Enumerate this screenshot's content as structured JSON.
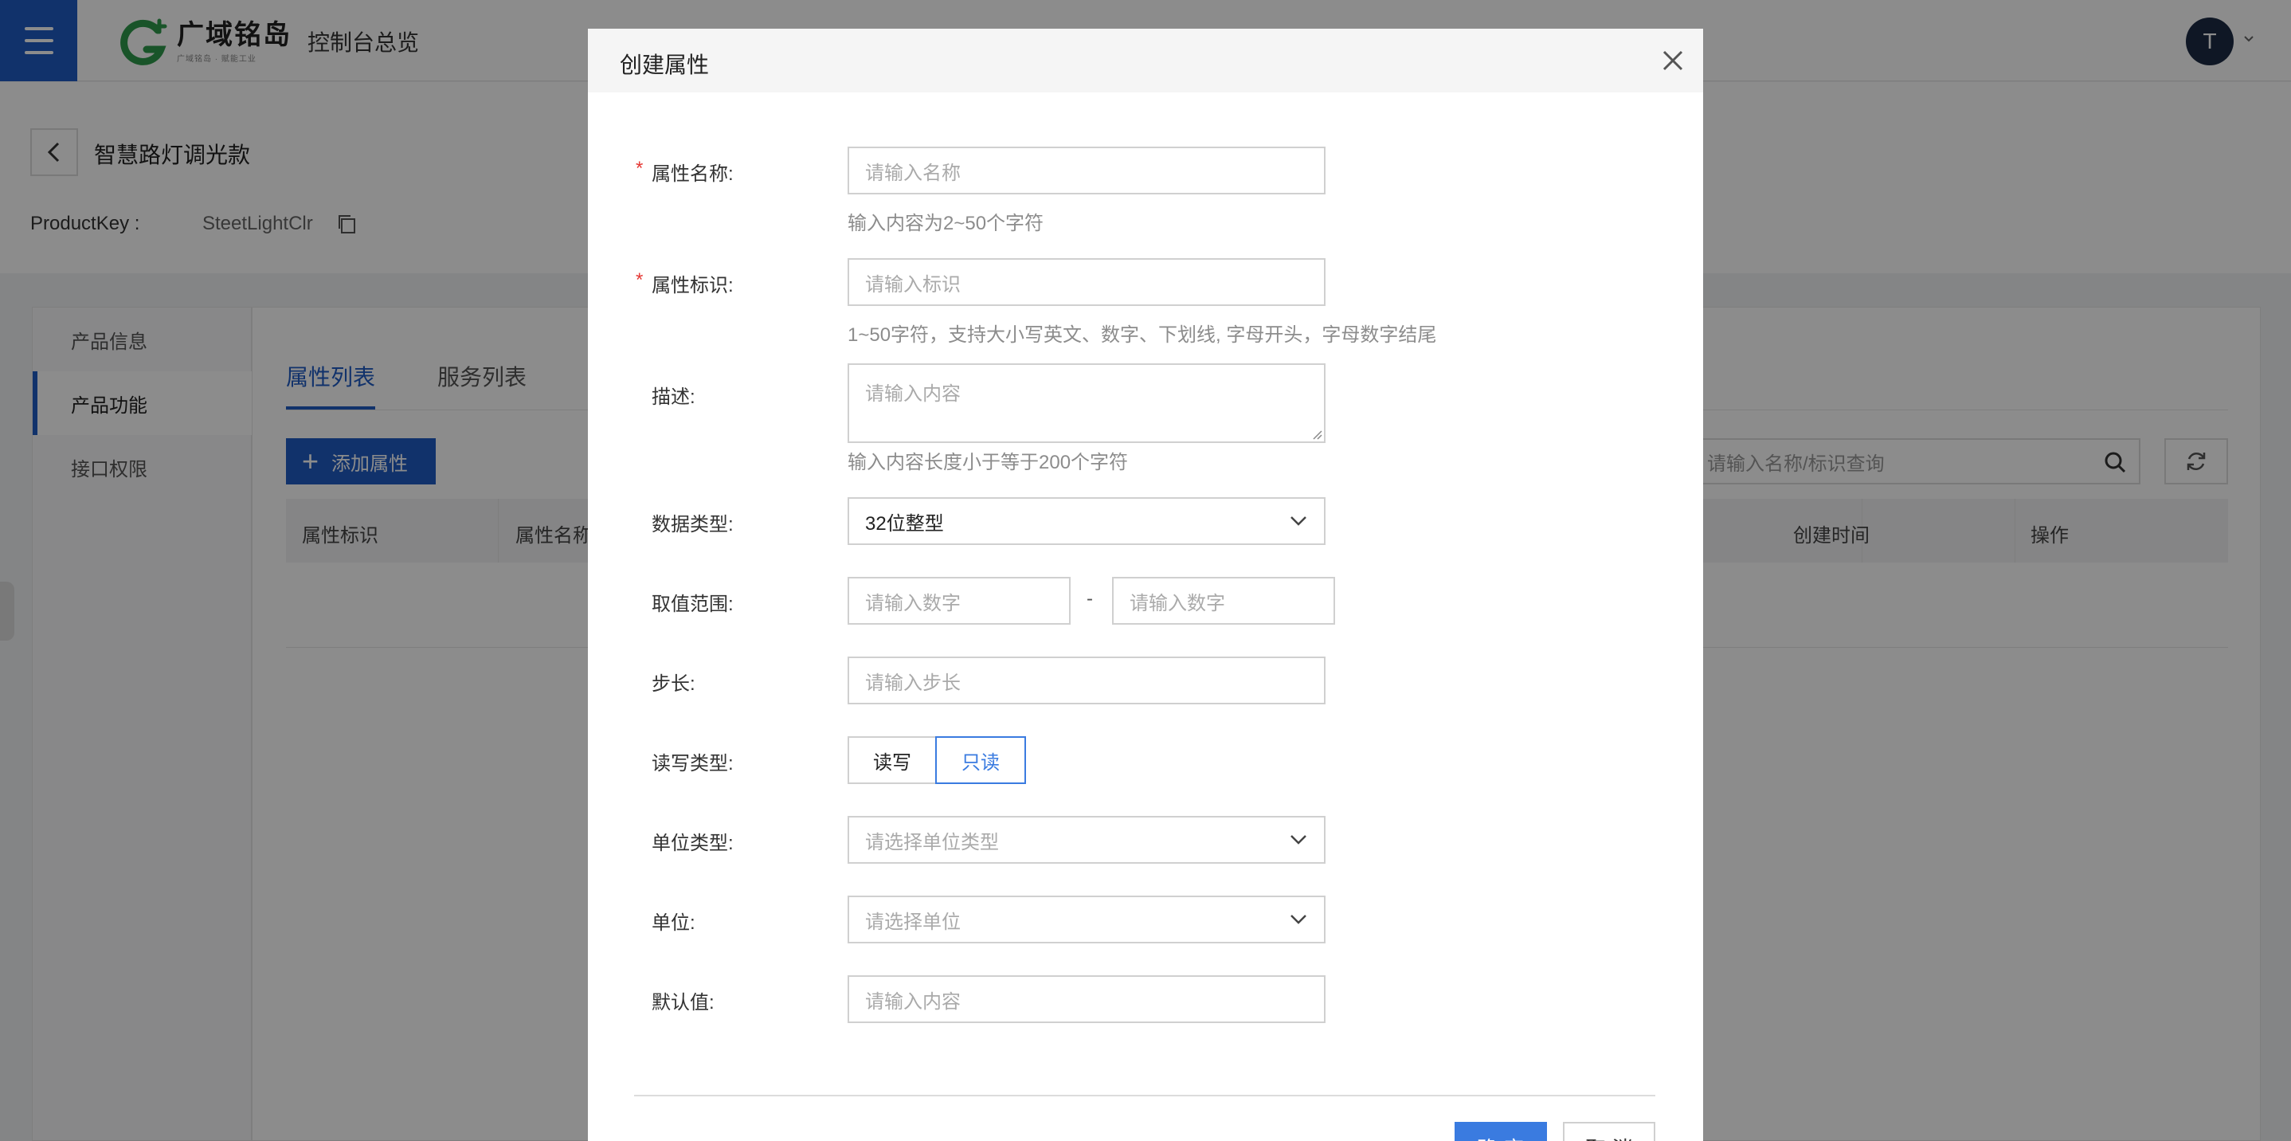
{
  "header": {
    "brand_name": "广域铭岛",
    "brand_tagline": "广域铭岛 · 赋能工业",
    "console_label": "控制台总览",
    "avatar_initial": "T"
  },
  "product": {
    "title": "智慧路灯调光款",
    "key_label": "ProductKey :",
    "key_value": "SteetLightClr"
  },
  "leftnav": {
    "items": [
      {
        "label": "产品信息",
        "active": false
      },
      {
        "label": "产品功能",
        "active": true
      },
      {
        "label": "接口权限",
        "active": false
      }
    ]
  },
  "main": {
    "tabs": [
      {
        "label": "属性列表",
        "active": true
      },
      {
        "label": "服务列表",
        "active": false
      }
    ],
    "add_button": "添加属性",
    "search_placeholder": "请输入名称/标识查询",
    "columns": [
      "属性标识",
      "属性名称",
      "创建时间",
      "操作"
    ]
  },
  "modal": {
    "title": "创建属性",
    "fields": {
      "name": {
        "label": "属性名称:",
        "placeholder": "请输入名称",
        "hint": "输入内容为2~50个字符",
        "required": "*"
      },
      "identifier": {
        "label": "属性标识:",
        "placeholder": "请输入标识",
        "hint": "1~50字符，支持大小写英文、数字、下划线, 字母开头，字母数字结尾",
        "required": "*"
      },
      "description": {
        "label": "描述:",
        "placeholder": "请输入内容",
        "hint": "输入内容长度小于等于200个字符"
      },
      "data_type": {
        "label": "数据类型:",
        "value": "32位整型"
      },
      "range": {
        "label": "取值范围:",
        "min_placeholder": "请输入数字",
        "max_placeholder": "请输入数字",
        "separator": "-"
      },
      "step": {
        "label": "步长:",
        "placeholder": "请输入步长"
      },
      "rw_type": {
        "label": "读写类型:",
        "options": [
          "读写",
          "只读"
        ],
        "selected": "只读"
      },
      "unit_type": {
        "label": "单位类型:",
        "placeholder": "请选择单位类型"
      },
      "unit": {
        "label": "单位:",
        "placeholder": "请选择单位"
      },
      "default_value": {
        "label": "默认值:",
        "placeholder": "请输入内容"
      }
    },
    "ok_label": "确 定",
    "cancel_label": "取 消"
  },
  "colors": {
    "primary": "#1f5bc4",
    "link_blue": "#3a7be0",
    "required_red": "#e53935",
    "brand_green": "#2e9a4b"
  }
}
